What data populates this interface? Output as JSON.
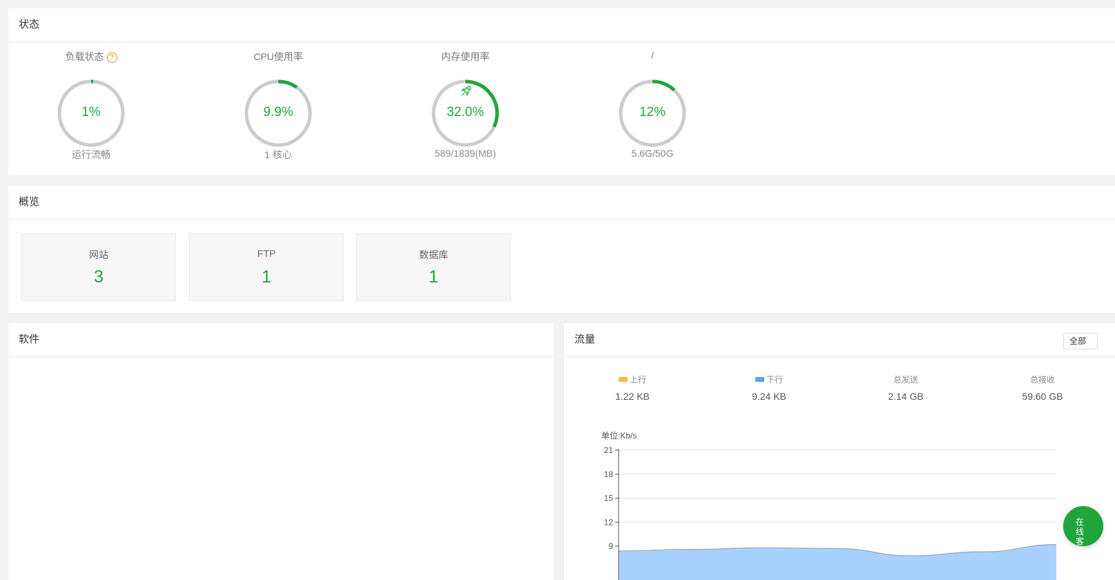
{
  "status": {
    "title": "状态",
    "gauges": [
      {
        "label": "负载状态",
        "value_text": "1%",
        "percent": 1,
        "sub": "运行流畅",
        "has_help": true
      },
      {
        "label": "CPU使用率",
        "value_text": "9.9%",
        "percent": 9.9,
        "sub": "1 核心"
      },
      {
        "label": "内存使用率",
        "value_text": "32.0%",
        "percent": 32.0,
        "sub": "589/1839(MB)",
        "has_rocket": true
      },
      {
        "label": "/",
        "value_text": "12%",
        "percent": 12,
        "sub": "5.6G/50G"
      }
    ],
    "help_glyph": "?"
  },
  "overview": {
    "title": "概览",
    "cards": [
      {
        "label": "网站",
        "value": "3"
      },
      {
        "label": "FTP",
        "value": "1"
      },
      {
        "label": "数据库",
        "value": "1"
      }
    ]
  },
  "software": {
    "title": "软件"
  },
  "traffic": {
    "title": "流量",
    "filter_label": "全部",
    "stats": [
      {
        "name": "上行",
        "value": "1.22 KB",
        "color": "#f7b851"
      },
      {
        "name": "下行",
        "value": "9.24 KB",
        "color": "#52a9ff"
      },
      {
        "name": "总发送",
        "value": "2.14 GB"
      },
      {
        "name": "总接收",
        "value": "59.60 GB"
      }
    ],
    "chart_data": {
      "type": "area",
      "ylabel": "单位:Kb/s",
      "yticks": [
        9,
        12,
        15,
        18,
        21
      ],
      "ylim": [
        9,
        21
      ],
      "grid": true,
      "series": [
        {
          "name": "下行",
          "color": "#52a9ff",
          "values": [
            8.4,
            8.6,
            8.8,
            8.7,
            7.8,
            8.3,
            9.2
          ]
        }
      ]
    }
  },
  "float_service": {
    "label": "在线客服"
  },
  "colors": {
    "accent": "#20a53a",
    "ring_bg": "#cccccc"
  }
}
